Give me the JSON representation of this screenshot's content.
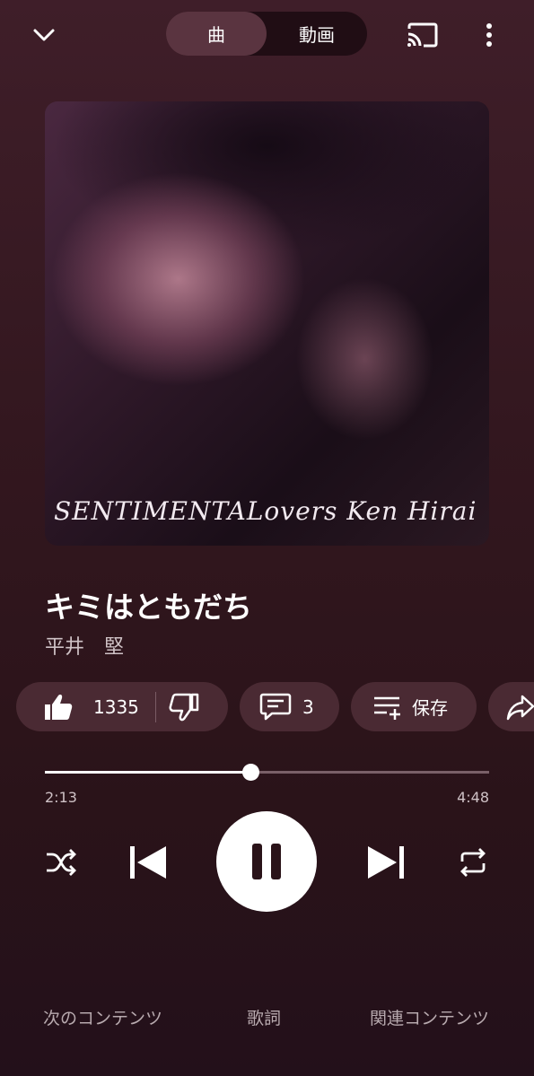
{
  "header": {
    "tabs": [
      {
        "label": "曲",
        "active": true
      },
      {
        "label": "動画",
        "active": false
      }
    ]
  },
  "album_art": {
    "caption": "SENTIMENTALovers Ken Hirai"
  },
  "track": {
    "title": "キミはともだち",
    "artist": "平井　堅"
  },
  "actions": {
    "like_count": "1335",
    "comment_count": "3",
    "save_label": "保存"
  },
  "playback": {
    "current_time": "2:13",
    "total_time": "4:48",
    "progress_fraction": 0.462,
    "state": "playing"
  },
  "bottom_tabs": [
    {
      "label": "次のコンテンツ"
    },
    {
      "label": "歌詞"
    },
    {
      "label": "関連コンテンツ"
    }
  ],
  "colors": {
    "background": "#3f1e29",
    "chip": "#4a2a33",
    "accent": "#ffffff"
  }
}
